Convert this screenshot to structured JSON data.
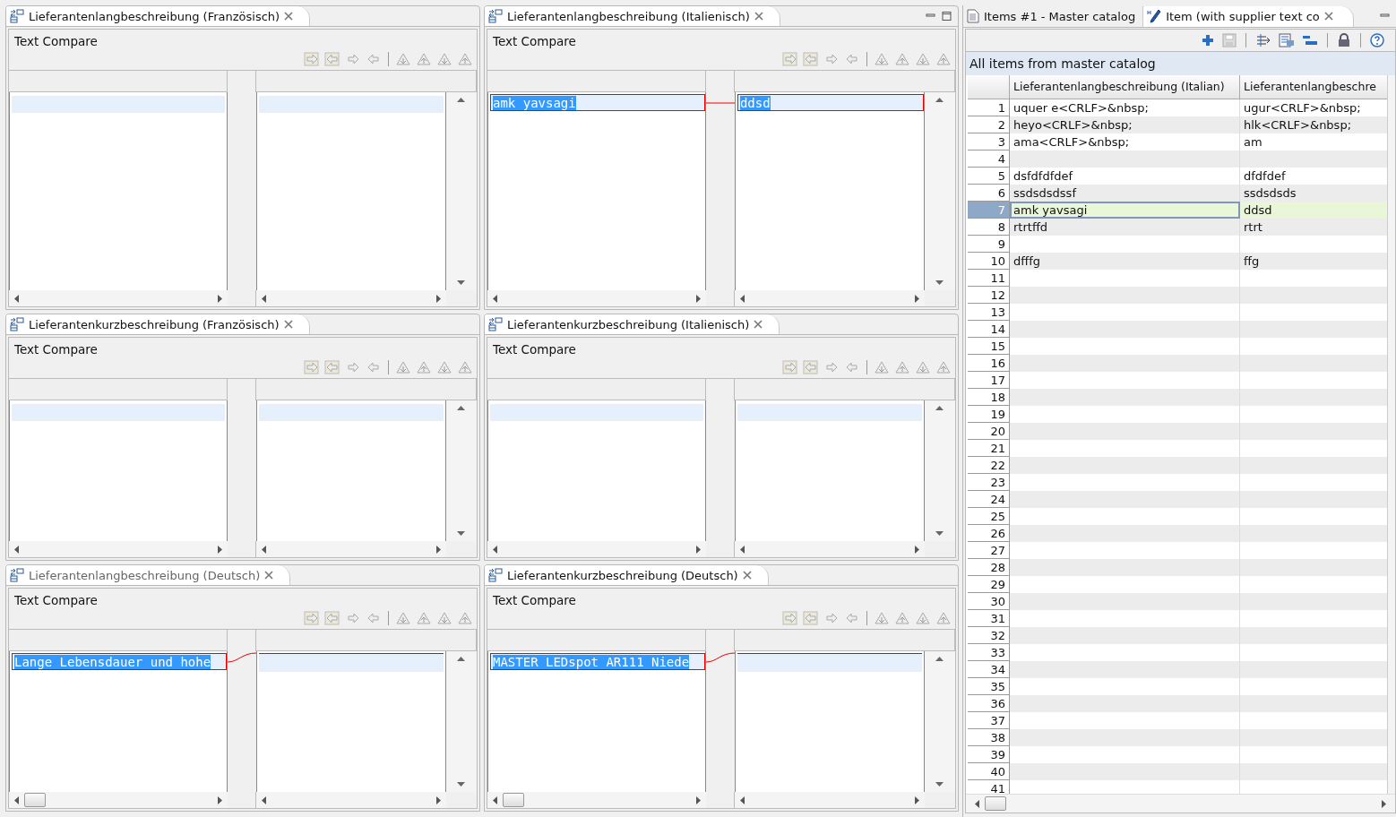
{
  "compare_columns": [
    [
      {
        "title": "Lieferantenlangbeschreibung (Französisch)",
        "header": "Text Compare",
        "diff": false,
        "scroll_thumb": false,
        "window_controls": false,
        "dimmed": false
      },
      {
        "title": "Lieferantenkurzbeschreibung (Französisch)",
        "header": "Text Compare",
        "diff": false,
        "scroll_thumb": false,
        "window_controls": false,
        "dimmed": false
      },
      {
        "title": "Lieferantenlangbeschreibung (Deutsch)",
        "header": "Text Compare",
        "left_text": "Lange Lebensdauer und hohe",
        "diff": true,
        "scroll_thumb": true,
        "window_controls": false,
        "dimmed": true
      }
    ],
    [
      {
        "title": "Lieferantenlangbeschreibung (Italienisch)",
        "header": "Text Compare",
        "left_text": "amk yavsagi",
        "right_text": "ddsd",
        "diff": true,
        "scroll_thumb": false,
        "window_controls": true,
        "dimmed": false
      },
      {
        "title": "Lieferantenkurzbeschreibung (Italienisch)",
        "header": "Text Compare",
        "diff": false,
        "scroll_thumb": false,
        "window_controls": false,
        "dimmed": false
      },
      {
        "title": "Lieferantenkurzbeschreibung (Deutsch)",
        "header": "Text Compare",
        "left_text": "MASTER LEDspot AR111 Niede",
        "diff": true,
        "scroll_thumb": true,
        "window_controls": false,
        "dimmed": false
      }
    ]
  ],
  "item_editor": {
    "tabs": [
      {
        "label": "Items #1 - Master catalog",
        "kind": "document",
        "selected": false
      },
      {
        "label": "Item (with supplier text co",
        "kind": "edit",
        "selected": true
      }
    ],
    "section_title": "All items from master catalog",
    "columns": [
      "Lieferantenlangbeschreibung (Italian)",
      "Lieferantenlangbeschre"
    ],
    "rows": [
      {
        "n": "1",
        "cells": [
          "uquer e<CRLF>&nbsp;",
          "ugur<CRLF>&nbsp;"
        ],
        "selected": false
      },
      {
        "n": "2",
        "cells": [
          "heyo<CRLF>&nbsp;",
          "hlk<CRLF>&nbsp;"
        ],
        "selected": false
      },
      {
        "n": "3",
        "cells": [
          "ama<CRLF>&nbsp;",
          "am"
        ],
        "selected": false
      },
      {
        "n": "4",
        "selected": false
      },
      {
        "n": "5",
        "cells": [
          "dsfdfdfdef",
          "dfdfdef"
        ],
        "selected": false
      },
      {
        "n": "6",
        "cells": [
          "ssdsdsdssf",
          "ssdsdsds"
        ],
        "selected": false
      },
      {
        "n": "7",
        "cells": [
          "amk yavsagi",
          "ddsd"
        ],
        "selected": true
      },
      {
        "n": "8",
        "cells": [
          "rtrtffd",
          "rtrt"
        ],
        "selected": false
      },
      {
        "n": "9",
        "selected": false
      },
      {
        "n": "10",
        "cells": [
          "dfffg",
          "ffg"
        ],
        "selected": false
      },
      {
        "n": "11",
        "selected": false
      },
      {
        "n": "12",
        "selected": false
      },
      {
        "n": "13",
        "selected": false
      },
      {
        "n": "14",
        "selected": false
      },
      {
        "n": "15",
        "selected": false
      },
      {
        "n": "16",
        "selected": false
      },
      {
        "n": "17",
        "selected": false
      },
      {
        "n": "18",
        "selected": false
      },
      {
        "n": "19",
        "selected": false
      },
      {
        "n": "20",
        "selected": false
      },
      {
        "n": "21",
        "selected": false
      },
      {
        "n": "22",
        "selected": false
      },
      {
        "n": "23",
        "selected": false
      },
      {
        "n": "24",
        "selected": false
      },
      {
        "n": "25",
        "selected": false
      },
      {
        "n": "26",
        "selected": false
      },
      {
        "n": "27",
        "selected": false
      },
      {
        "n": "28",
        "selected": false
      },
      {
        "n": "29",
        "selected": false
      },
      {
        "n": "30",
        "selected": false
      },
      {
        "n": "31",
        "selected": false
      },
      {
        "n": "32",
        "selected": false
      },
      {
        "n": "33",
        "selected": false
      },
      {
        "n": "34",
        "selected": false
      },
      {
        "n": "35",
        "selected": false
      },
      {
        "n": "36",
        "selected": false
      },
      {
        "n": "37",
        "selected": false
      },
      {
        "n": "38",
        "selected": false
      },
      {
        "n": "39",
        "selected": false
      },
      {
        "n": "40",
        "selected": false
      },
      {
        "n": "41",
        "selected": false
      }
    ]
  }
}
